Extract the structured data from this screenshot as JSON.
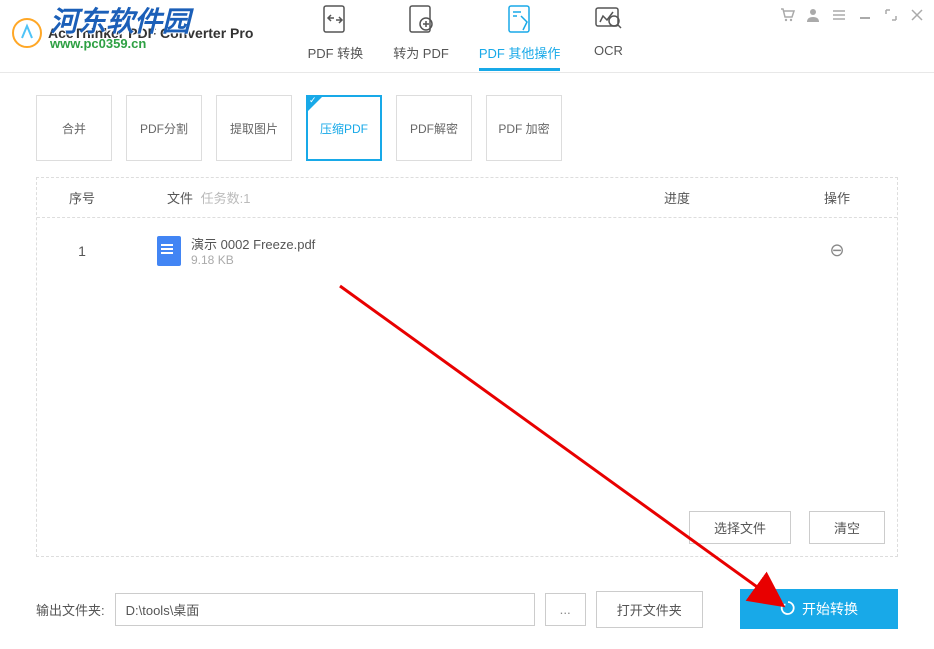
{
  "app": {
    "title": "AceThinker PDF Converter Pro"
  },
  "watermark": {
    "line1": "河东软件园",
    "line2": "www.pc0359.cn"
  },
  "mainTabs": [
    {
      "label": "PDF 转换"
    },
    {
      "label": "转为 PDF"
    },
    {
      "label": "PDF 其他操作"
    },
    {
      "label": "OCR"
    }
  ],
  "subTabs": [
    {
      "label": "合并"
    },
    {
      "label": "PDF分割"
    },
    {
      "label": "提取图片"
    },
    {
      "label": "压缩PDF"
    },
    {
      "label": "PDF解密"
    },
    {
      "label": "PDF 加密"
    }
  ],
  "table": {
    "headers": {
      "seq": "序号",
      "file": "文件",
      "taskCount": "任务数:1",
      "progress": "进度",
      "operation": "操作"
    },
    "rows": [
      {
        "seq": "1",
        "name": "演示 0002 Freeze.pdf",
        "size": "9.18 KB"
      }
    ]
  },
  "actions": {
    "selectFile": "选择文件",
    "clear": "清空"
  },
  "footer": {
    "outputLabel": "输出文件夹:",
    "outputPath": "D:\\tools\\桌面",
    "browse": "...",
    "openFolder": "打开文件夹",
    "start": "开始转换"
  }
}
